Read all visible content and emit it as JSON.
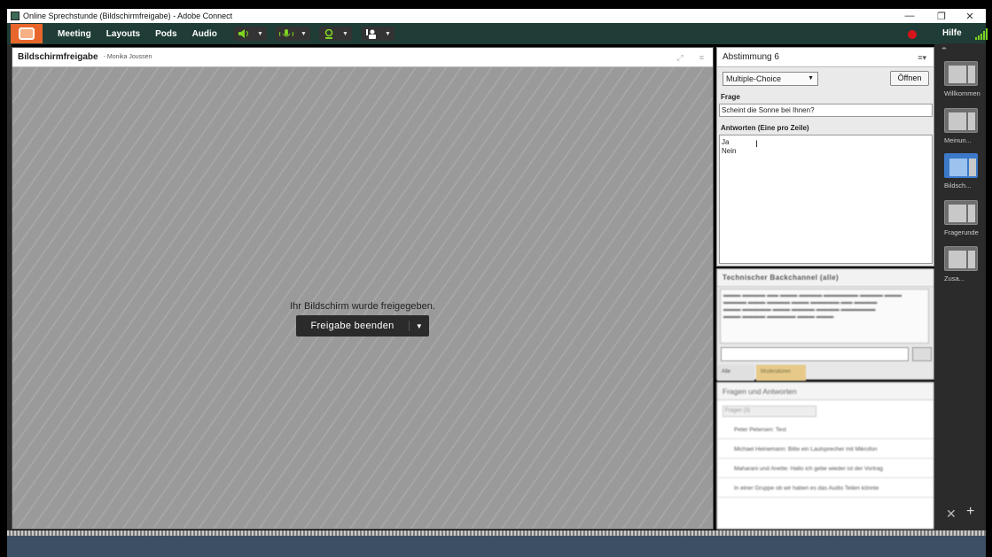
{
  "window": {
    "title": "Online Sprechstunde (Bildschirmfreigabe) - Adobe Connect",
    "minimize": "—",
    "restore": "❐",
    "close": "✕"
  },
  "menubar": {
    "items": [
      "Meeting",
      "Layouts",
      "Pods",
      "Audio"
    ],
    "help_label": "Hilfe",
    "colors": {
      "bar": "#1f3d36",
      "logo": "#e8662b",
      "recording": "#d7141a"
    }
  },
  "toolbar_icons": [
    "speaker-icon",
    "microphone-icon",
    "webcam-icon",
    "raise-hand-icon"
  ],
  "share_pod": {
    "title": "Bildschirmfreigabe",
    "presenter": "- Monika Joussen",
    "status_message": "Ihr Bildschirm wurde freigegeben.",
    "stop_button": "Freigabe beenden"
  },
  "poll_pod": {
    "title": "Abstimmung 6",
    "type_selected": "Multiple-Choice",
    "open_button": "Öffnen",
    "question_label": "Frage",
    "question_value": "Scheint die Sonne bei Ihnen?",
    "answers_label": "Antworten (Eine pro Zeile)",
    "answers": [
      "Ja",
      "Nein"
    ]
  },
  "chat_pod": {
    "title": "Technischer Backchannel (alle)",
    "tabs": [
      "Alle",
      "Moderatoren"
    ]
  },
  "qa_pod": {
    "title": "Fragen und Antworten",
    "filter": "Fragen (3)",
    "rows": [
      "Peter Petersen: Test",
      "Michael Heinemann: Bitte ein Lautsprecher mit Mikrofon",
      "Maharani und Anette: Hallo ich gebe wieder ist der Vortrag",
      "In einer Gruppe ob wir haben es das Audio Teilen könnte"
    ]
  },
  "layouts_rail": {
    "items": [
      {
        "label": "Willkommen",
        "selected": false
      },
      {
        "label": "Meinun...",
        "selected": false
      },
      {
        "label": "Bildsch...",
        "selected": true
      },
      {
        "label": "Fragerunde",
        "selected": false
      },
      {
        "label": "Zusa...",
        "selected": false
      }
    ]
  }
}
